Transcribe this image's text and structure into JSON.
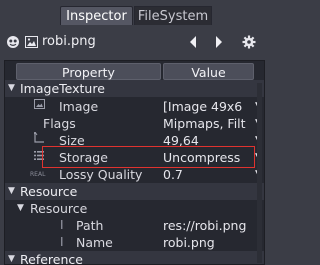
{
  "tabs": {
    "inspector": "Inspector",
    "filesystem": "FileSystem"
  },
  "toolbar": {
    "resource_name": "robi.png",
    "icons": [
      "godot-icon",
      "image-icon",
      "back-arrow-icon",
      "forward-arrow-icon",
      "gear-icon"
    ]
  },
  "table": {
    "header_property": "Property",
    "header_value": "Value"
  },
  "rows": {
    "image_texture_section": "ImageTexture",
    "image_label": "Image",
    "image_value": "[Image 49x6",
    "flags_label": "Flags",
    "flags_value": "Mipmaps, Filt",
    "size_label": "Size",
    "size_value": "49,64",
    "storage_label": "Storage",
    "storage_value": "Uncompress",
    "lossy_tag": "REAL",
    "lossy_label": "Lossy Quality",
    "lossy_value": "0.7",
    "resource_section": "Resource",
    "resource_subsection": "Resource",
    "path_label": "Path",
    "path_value": "res://robi.png",
    "name_label": "Name",
    "name_value": "robi.png",
    "reference_section": "Reference"
  },
  "colors": {
    "highlight": "#e0332f",
    "background": "#3b3d46",
    "panel": "#262830"
  }
}
